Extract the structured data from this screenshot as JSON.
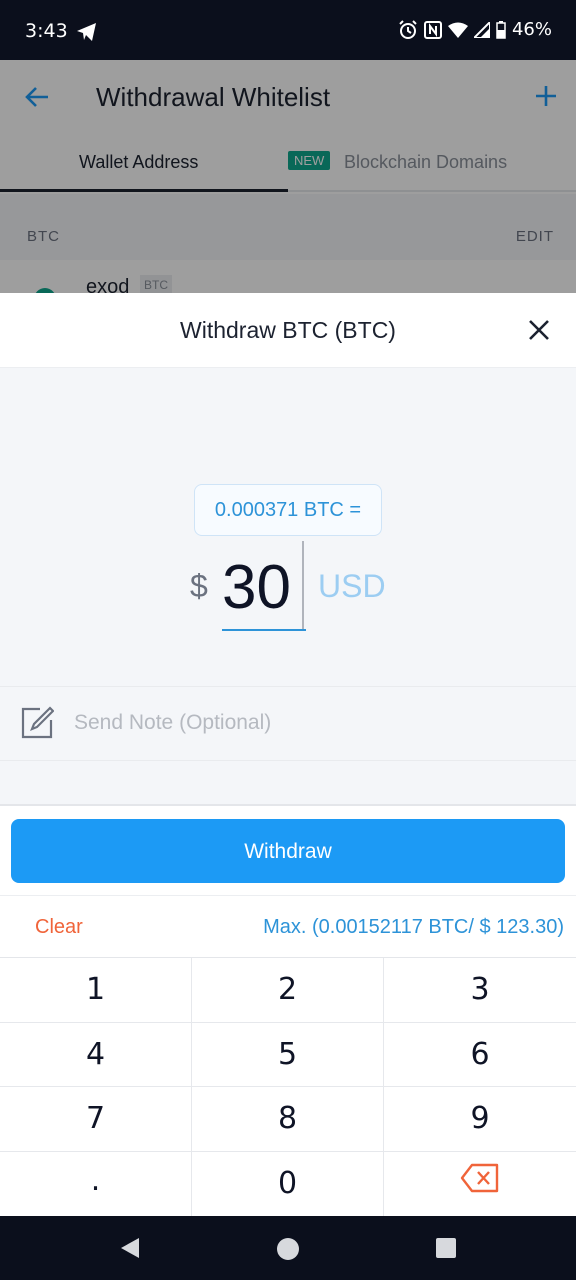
{
  "status_bar": {
    "time": "3:43",
    "battery": "46%"
  },
  "background_screen": {
    "title": "Withdrawal Whitelist",
    "tabs": [
      "Wallet Address",
      "Blockchain Domains"
    ],
    "new_badge": "NEW",
    "section_label": "BTC",
    "edit_label": "EDIT",
    "row_name": "exod",
    "row_tag": "BTC"
  },
  "sheet": {
    "title": "Withdraw BTC (BTC)",
    "conversion": "0.000371 BTC =",
    "currency_symbol": "$",
    "amount": "30",
    "unit": "USD",
    "note_placeholder": "Send Note (Optional)",
    "withdraw_label": "Withdraw",
    "clear_label": "Clear",
    "max_label": "Max. (0.00152117 BTC/ $ 123.30)"
  },
  "keypad": {
    "keys": [
      "1",
      "2",
      "3",
      "4",
      "5",
      "6",
      "7",
      "8",
      "9",
      ".",
      "0"
    ]
  },
  "colors": {
    "accent": "#1c9af5",
    "clear": "#f0643a",
    "link": "#2d93d8"
  },
  "icons": {
    "status": [
      "telegram-icon",
      "alarm-icon",
      "nfc-icon",
      "wifi-icon",
      "signal-icon",
      "battery-icon"
    ],
    "header": [
      "back-arrow-icon",
      "plus-icon",
      "close-icon"
    ],
    "note": "edit-note-icon",
    "keypad": "backspace-icon",
    "nav": [
      "nav-back-icon",
      "nav-home-icon",
      "nav-recents-icon"
    ]
  }
}
